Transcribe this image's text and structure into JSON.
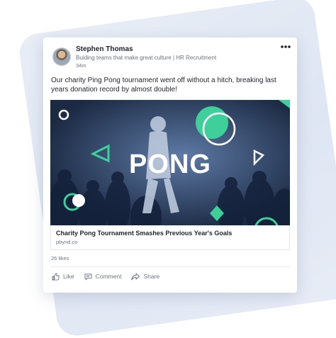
{
  "post": {
    "author_name": "Stephen Thomas",
    "author_headline": "Buiding teams that make great culture | HR Recruitment",
    "time": "34m",
    "more_icon": "more-horizontal-icon",
    "text": "Our charity Ping Pong tournament went off without a hitch, breaking last years donation record by almost double!",
    "image_text": "PONG",
    "link_title": "Charity Pong Tournament Smashes Previous Year's Goals",
    "link_domain": "pbynd.co",
    "likes": "26 likes"
  },
  "actions": {
    "like_label": "Like",
    "comment_label": "Comment",
    "share_label": "Share",
    "like_icon": "thumbs-up-icon",
    "comment_icon": "comment-icon",
    "share_icon": "share-icon"
  },
  "colors": {
    "accent_green": "#3ecf9a",
    "image_tint": "#21324e",
    "backdrop": "#e3e9f4"
  }
}
